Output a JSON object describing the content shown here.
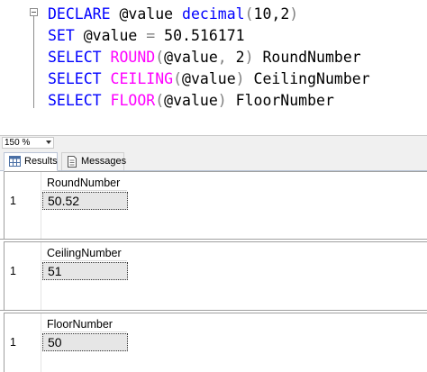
{
  "editor": {
    "line1": {
      "kw": "DECLARE",
      "rest": " @value ",
      "type": "decimal",
      "open": "(",
      "args": "10,2",
      "close": ")"
    },
    "line2": {
      "kw": "SET",
      "rest": " @value ",
      "eq": "=",
      "val": " 50.516171"
    },
    "line3": {
      "kw": "SELECT",
      "fn": "ROUND",
      "open": "(",
      "arg": "@value",
      "comma": ",",
      "arg2": " 2",
      "close": ")",
      "alias": " RoundNumber"
    },
    "line4": {
      "kw": "SELECT",
      "fn": "CEILING",
      "open": "(",
      "arg": "@value",
      "close": ")",
      "alias": " CeilingNumber"
    },
    "line5": {
      "kw": "SELECT",
      "fn": "FLOOR",
      "open": "(",
      "arg": "@value",
      "close": ")",
      "alias": " FloorNumber"
    }
  },
  "zoom": {
    "value": "150 %"
  },
  "tabs": {
    "results": "Results",
    "messages": "Messages"
  },
  "results": [
    {
      "column": "RoundNumber",
      "row": "1",
      "value": "50.52"
    },
    {
      "column": "CeilingNumber",
      "row": "1",
      "value": "51"
    },
    {
      "column": "FloorNumber",
      "row": "1",
      "value": "50"
    }
  ],
  "colors": {
    "keyword": "#0000ff",
    "function": "#ff00ff",
    "operator": "#808080",
    "selected_cell": "#e6e6e6"
  },
  "icons": {
    "results_tab": "grid-icon",
    "messages_tab": "document-icon",
    "zoom_dropdown": "chevron-down-icon",
    "collapse": "collapse-minus-icon"
  }
}
